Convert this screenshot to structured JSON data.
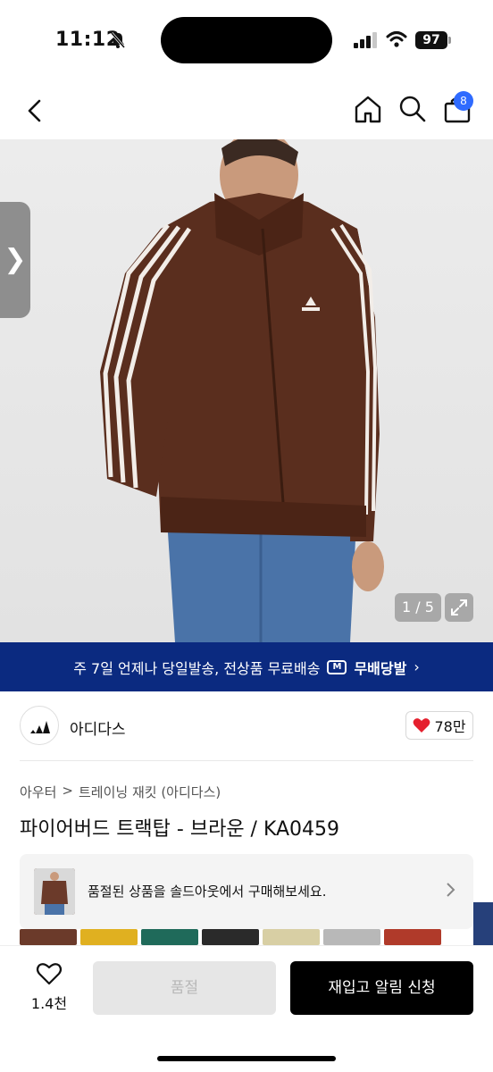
{
  "status_bar": {
    "time": "11:12",
    "battery": "97"
  },
  "nav": {
    "cart_badge": "8"
  },
  "hero": {
    "counter": "1 / 5",
    "side_tab_glyph": "❯"
  },
  "shipping_banner": {
    "text": "주 7일 언제나 당일발송, 전상품 무료배송",
    "service": "무배당발",
    "chevron": "›"
  },
  "brand": {
    "name": "아디다스",
    "likes": "78만"
  },
  "breadcrumb": {
    "category": "아우터",
    "separator": ">",
    "subcategory": "트레이닝 재킷 (아디다스)"
  },
  "product": {
    "title": "파이어버드 트랙탑 - 브라운 / KA0459"
  },
  "soldout_notice": {
    "message": "품절된 상품을 솔드아웃에서 구매해보세요."
  },
  "swatch_colors": [
    "#6b3a2a",
    "#e0b020",
    "#1f6a5a",
    "#2a2a2a",
    "#d8cfa4",
    "#b8b8b8",
    "#b03a2a"
  ],
  "bottom_bar": {
    "wish_count": "1.4천",
    "soldout_label": "품절",
    "restock_label": "재입고 알림 신청"
  },
  "colors": {
    "banner_bg": "#0b2a80",
    "badge": "#2f6bff",
    "heart": "#e5202e",
    "jacket": "#5a2e1e",
    "jeans": "#4a73a8"
  }
}
